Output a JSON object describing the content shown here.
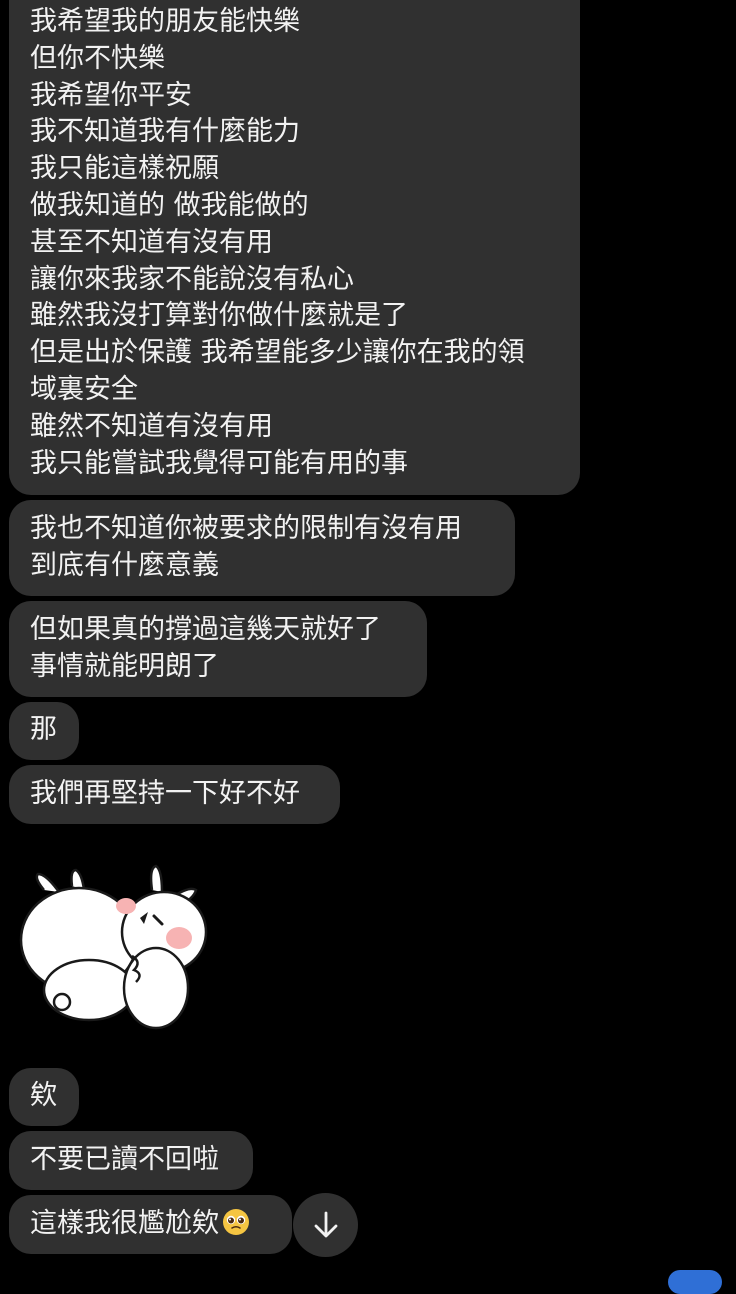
{
  "messages": [
    {
      "text": "我希望我的朋友能快樂\n但你不快樂\n我希望你平安\n我不知道我有什麼能力\n我只能這樣祝願\n做我知道的 做我能做的\n甚至不知道有沒有用\n讓你來我家不能說沒有私心\n雖然我沒打算對你做什麼就是了\n但是出於保護 我希望能多少讓你在我的領\n域裏安全\n雖然不知道有沒有用\n我只能嘗試我覺得可能有用的事"
    },
    {
      "text": "我也不知道你被要求的限制有沒有用\n到底有什麼意義"
    },
    {
      "text": "但如果真的撐過這幾天就好了\n事情就能明朗了"
    },
    {
      "text": "那"
    },
    {
      "text": "我們再堅持一下好不好"
    },
    {
      "text": "欸"
    },
    {
      "text": "不要已讀不回啦"
    },
    {
      "text": "這樣我很尷尬欸",
      "emoji": "pleading-face"
    }
  ],
  "sticker": {
    "name": "two-rabbits-hugging-sticker"
  },
  "scroll_button": {
    "icon": "arrow-down-icon"
  },
  "colors": {
    "background": "#000000",
    "bubble": "#303030",
    "text": "#f2f2f2",
    "accent": "#2f6fd6"
  }
}
